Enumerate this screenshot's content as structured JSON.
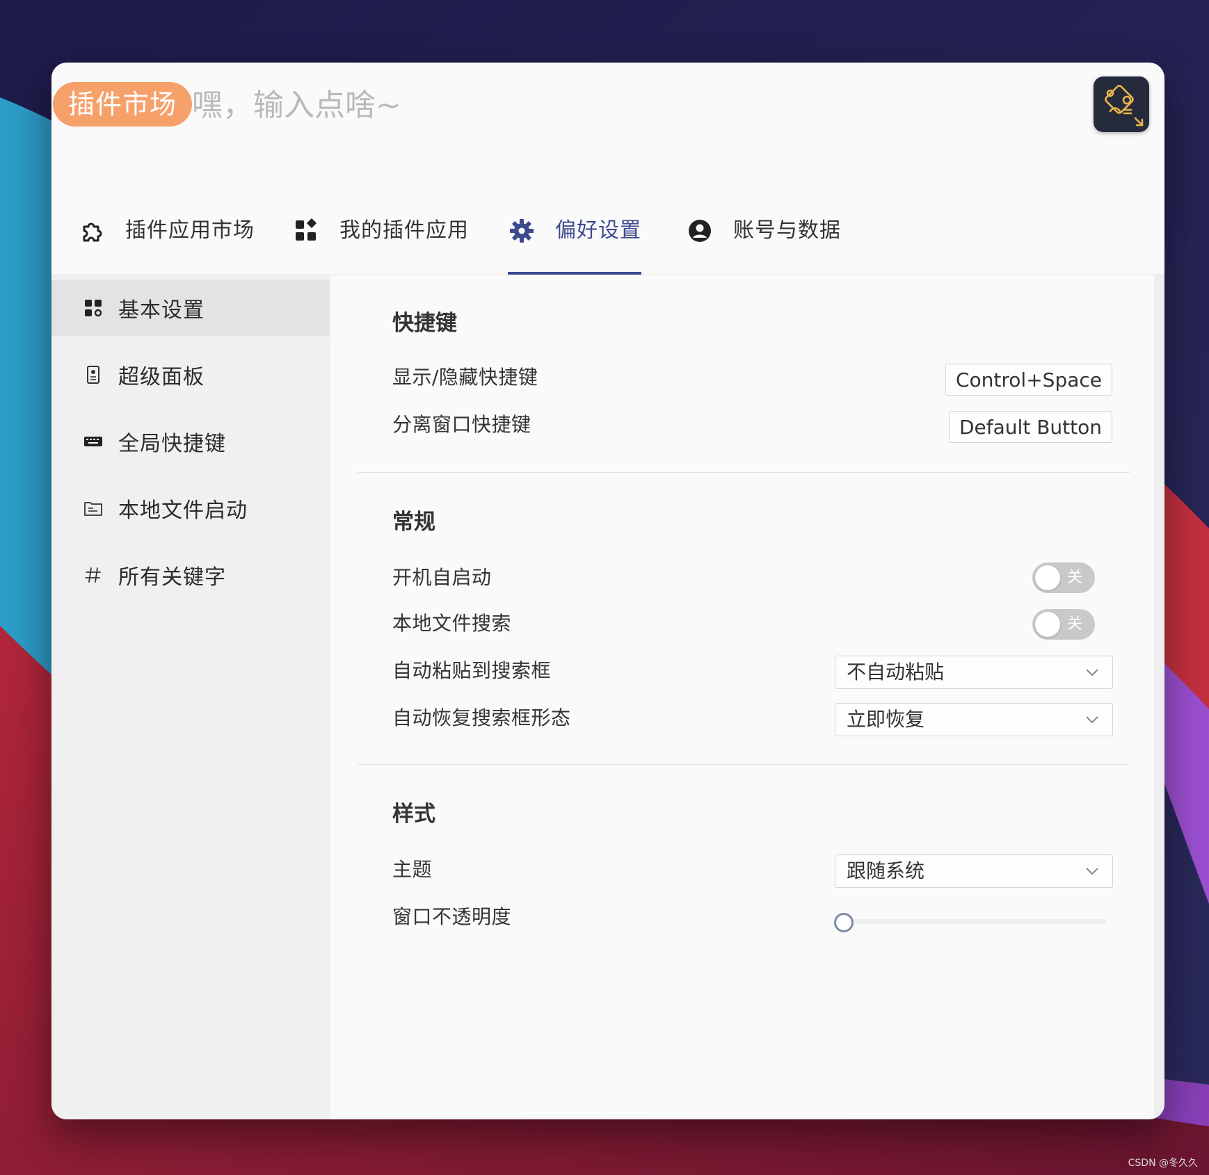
{
  "search": {
    "tag_label": "插件市场",
    "placeholder": "嘿，输入点啥~"
  },
  "tabs": [
    {
      "label": "插件应用市场",
      "icon": "puzzle-icon",
      "active": false
    },
    {
      "label": "我的插件应用",
      "icon": "apps-grid-icon",
      "active": false
    },
    {
      "label": "偏好设置",
      "icon": "gear-icon",
      "active": true
    },
    {
      "label": "账号与数据",
      "icon": "user-circle-icon",
      "active": false
    }
  ],
  "sidebar": {
    "items": [
      {
        "label": "基本设置",
        "icon": "settings-grid-icon",
        "active": true
      },
      {
        "label": "超级面板",
        "icon": "panel-icon",
        "active": false
      },
      {
        "label": "全局快捷键",
        "icon": "keyboard-icon",
        "active": false
      },
      {
        "label": "本地文件启动",
        "icon": "folder-file-icon",
        "active": false
      },
      {
        "label": "所有关键字",
        "icon": "hash-icon",
        "active": false
      }
    ]
  },
  "sections": {
    "shortcuts": {
      "title": "快捷键",
      "show_hide": {
        "label": "显示/隐藏快捷键",
        "value": "Control+Space"
      },
      "detach": {
        "label": "分离窗口快捷键",
        "value": "Default Button"
      }
    },
    "general": {
      "title": "常规",
      "autostart": {
        "label": "开机自启动",
        "state": "关"
      },
      "local_search": {
        "label": "本地文件搜索",
        "state": "关"
      },
      "auto_paste": {
        "label": "自动粘贴到搜索框",
        "value": "不自动粘贴"
      },
      "auto_restore": {
        "label": "自动恢复搜索框形态",
        "value": "立即恢复"
      }
    },
    "style": {
      "title": "样式",
      "theme": {
        "label": "主题",
        "value": "跟随系统"
      },
      "opacity": {
        "label": "窗口不透明度",
        "value": 0
      }
    }
  },
  "watermark": "CSDN @冬久久",
  "colors": {
    "accent": "#3d4a8f",
    "tag": "#f6a06a",
    "sidebar_bg": "#f1f0f0",
    "toggle_off": "#c9c9c9"
  }
}
